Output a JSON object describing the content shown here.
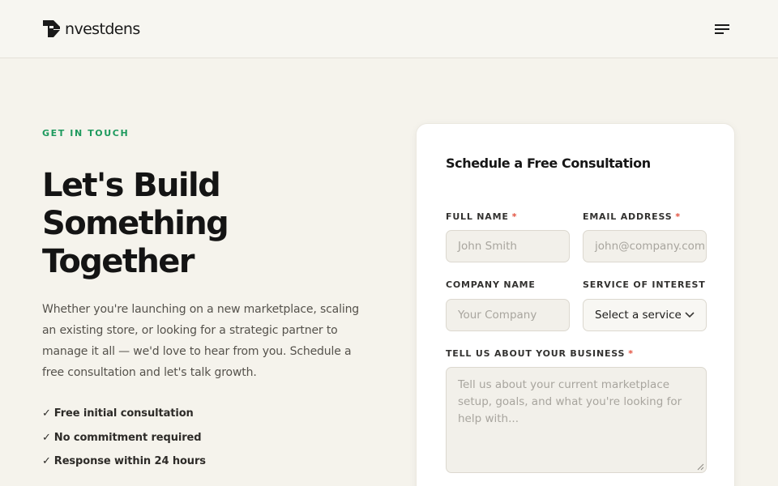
{
  "header": {
    "brand": "nvestdens",
    "menu_icon": "hamburger-menu-icon"
  },
  "hero": {
    "eyebrow": "GET IN TOUCH",
    "headline": [
      "Let's Build",
      "Something",
      "Together"
    ],
    "lead": "Whether you're launching on a new marketplace, scaling an existing store, or looking for a strategic partner to manage it all — we'd love to hear from you. Schedule a free consultation and let's talk growth.",
    "check_glyph": "✓",
    "benefits": [
      "Free initial consultation",
      "No commitment required",
      "Response within 24 hours"
    ]
  },
  "form": {
    "title": "Schedule a Free Consultation",
    "required_mark": "*",
    "full_name": {
      "label": "FULL NAME",
      "placeholder": "John Smith",
      "value": ""
    },
    "email": {
      "label": "EMAIL ADDRESS",
      "placeholder": "john@company.com",
      "value": ""
    },
    "company": {
      "label": "COMPANY NAME",
      "placeholder": "Your Company",
      "value": ""
    },
    "service": {
      "label": "SERVICE OF INTEREST",
      "selected": "Select a service"
    },
    "business": {
      "label": "TELL US ABOUT YOUR BUSINESS",
      "placeholder": "Tell us about your current marketplace setup, goals, and what you're looking for help with..."
    }
  },
  "colors": {
    "background": "#f5f3ec",
    "accent_green": "#1e9a5e",
    "required_red": "#e2503e"
  }
}
